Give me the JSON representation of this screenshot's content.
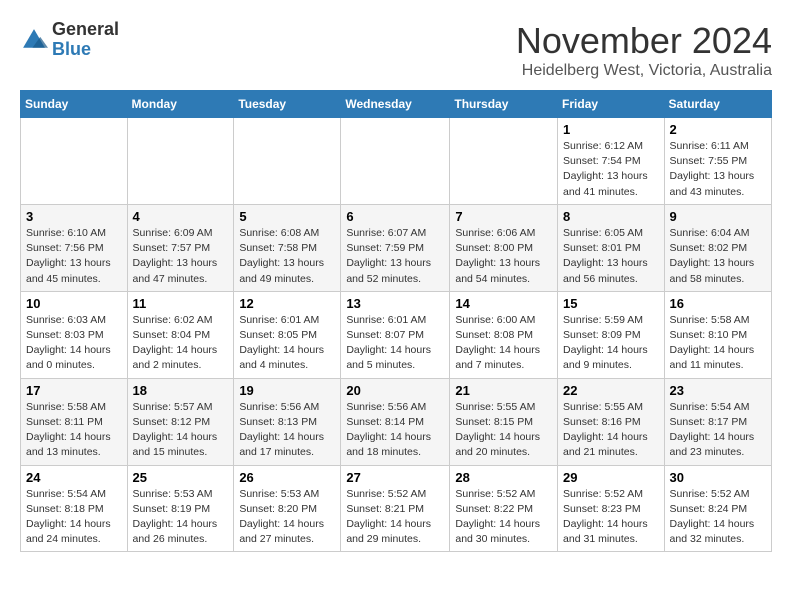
{
  "header": {
    "logo_general": "General",
    "logo_blue": "Blue",
    "month_title": "November 2024",
    "subtitle": "Heidelberg West, Victoria, Australia"
  },
  "days_of_week": [
    "Sunday",
    "Monday",
    "Tuesday",
    "Wednesday",
    "Thursday",
    "Friday",
    "Saturday"
  ],
  "weeks": [
    [
      {
        "day": "",
        "content": ""
      },
      {
        "day": "",
        "content": ""
      },
      {
        "day": "",
        "content": ""
      },
      {
        "day": "",
        "content": ""
      },
      {
        "day": "",
        "content": ""
      },
      {
        "day": "1",
        "content": "Sunrise: 6:12 AM\nSunset: 7:54 PM\nDaylight: 13 hours\nand 41 minutes."
      },
      {
        "day": "2",
        "content": "Sunrise: 6:11 AM\nSunset: 7:55 PM\nDaylight: 13 hours\nand 43 minutes."
      }
    ],
    [
      {
        "day": "3",
        "content": "Sunrise: 6:10 AM\nSunset: 7:56 PM\nDaylight: 13 hours\nand 45 minutes."
      },
      {
        "day": "4",
        "content": "Sunrise: 6:09 AM\nSunset: 7:57 PM\nDaylight: 13 hours\nand 47 minutes."
      },
      {
        "day": "5",
        "content": "Sunrise: 6:08 AM\nSunset: 7:58 PM\nDaylight: 13 hours\nand 49 minutes."
      },
      {
        "day": "6",
        "content": "Sunrise: 6:07 AM\nSunset: 7:59 PM\nDaylight: 13 hours\nand 52 minutes."
      },
      {
        "day": "7",
        "content": "Sunrise: 6:06 AM\nSunset: 8:00 PM\nDaylight: 13 hours\nand 54 minutes."
      },
      {
        "day": "8",
        "content": "Sunrise: 6:05 AM\nSunset: 8:01 PM\nDaylight: 13 hours\nand 56 minutes."
      },
      {
        "day": "9",
        "content": "Sunrise: 6:04 AM\nSunset: 8:02 PM\nDaylight: 13 hours\nand 58 minutes."
      }
    ],
    [
      {
        "day": "10",
        "content": "Sunrise: 6:03 AM\nSunset: 8:03 PM\nDaylight: 14 hours\nand 0 minutes."
      },
      {
        "day": "11",
        "content": "Sunrise: 6:02 AM\nSunset: 8:04 PM\nDaylight: 14 hours\nand 2 minutes."
      },
      {
        "day": "12",
        "content": "Sunrise: 6:01 AM\nSunset: 8:05 PM\nDaylight: 14 hours\nand 4 minutes."
      },
      {
        "day": "13",
        "content": "Sunrise: 6:01 AM\nSunset: 8:07 PM\nDaylight: 14 hours\nand 5 minutes."
      },
      {
        "day": "14",
        "content": "Sunrise: 6:00 AM\nSunset: 8:08 PM\nDaylight: 14 hours\nand 7 minutes."
      },
      {
        "day": "15",
        "content": "Sunrise: 5:59 AM\nSunset: 8:09 PM\nDaylight: 14 hours\nand 9 minutes."
      },
      {
        "day": "16",
        "content": "Sunrise: 5:58 AM\nSunset: 8:10 PM\nDaylight: 14 hours\nand 11 minutes."
      }
    ],
    [
      {
        "day": "17",
        "content": "Sunrise: 5:58 AM\nSunset: 8:11 PM\nDaylight: 14 hours\nand 13 minutes."
      },
      {
        "day": "18",
        "content": "Sunrise: 5:57 AM\nSunset: 8:12 PM\nDaylight: 14 hours\nand 15 minutes."
      },
      {
        "day": "19",
        "content": "Sunrise: 5:56 AM\nSunset: 8:13 PM\nDaylight: 14 hours\nand 17 minutes."
      },
      {
        "day": "20",
        "content": "Sunrise: 5:56 AM\nSunset: 8:14 PM\nDaylight: 14 hours\nand 18 minutes."
      },
      {
        "day": "21",
        "content": "Sunrise: 5:55 AM\nSunset: 8:15 PM\nDaylight: 14 hours\nand 20 minutes."
      },
      {
        "day": "22",
        "content": "Sunrise: 5:55 AM\nSunset: 8:16 PM\nDaylight: 14 hours\nand 21 minutes."
      },
      {
        "day": "23",
        "content": "Sunrise: 5:54 AM\nSunset: 8:17 PM\nDaylight: 14 hours\nand 23 minutes."
      }
    ],
    [
      {
        "day": "24",
        "content": "Sunrise: 5:54 AM\nSunset: 8:18 PM\nDaylight: 14 hours\nand 24 minutes."
      },
      {
        "day": "25",
        "content": "Sunrise: 5:53 AM\nSunset: 8:19 PM\nDaylight: 14 hours\nand 26 minutes."
      },
      {
        "day": "26",
        "content": "Sunrise: 5:53 AM\nSunset: 8:20 PM\nDaylight: 14 hours\nand 27 minutes."
      },
      {
        "day": "27",
        "content": "Sunrise: 5:52 AM\nSunset: 8:21 PM\nDaylight: 14 hours\nand 29 minutes."
      },
      {
        "day": "28",
        "content": "Sunrise: 5:52 AM\nSunset: 8:22 PM\nDaylight: 14 hours\nand 30 minutes."
      },
      {
        "day": "29",
        "content": "Sunrise: 5:52 AM\nSunset: 8:23 PM\nDaylight: 14 hours\nand 31 minutes."
      },
      {
        "day": "30",
        "content": "Sunrise: 5:52 AM\nSunset: 8:24 PM\nDaylight: 14 hours\nand 32 minutes."
      }
    ]
  ]
}
